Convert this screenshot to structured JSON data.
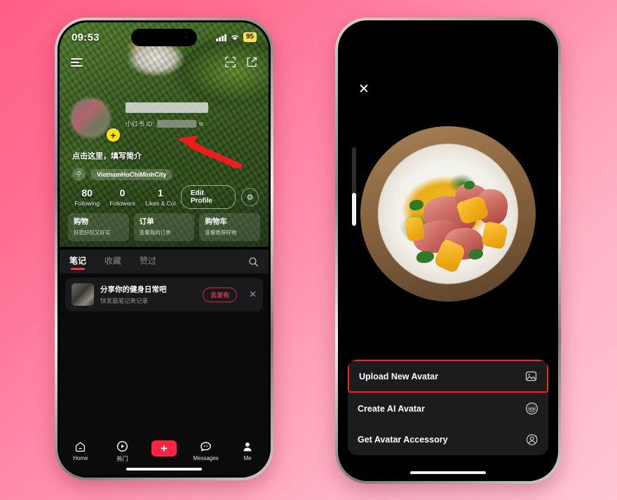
{
  "background": {
    "color_start": "#ff5f86",
    "color_end": "#ffc6d4"
  },
  "left_phone": {
    "status_bar": {
      "time": "09:53",
      "battery": "95",
      "signal_icon": "cellular-signal-icon",
      "wifi_icon": "wifi-icon"
    },
    "header_icons": {
      "menu_icon": "hamburger-menu-icon",
      "scan_icon": "qr-scan-icon",
      "share_icon": "share-icon"
    },
    "profile": {
      "avatar_icon": "avatar",
      "add_badge": "+",
      "id_label": "小红书 ID:",
      "copy_icon": "copy-icon",
      "bio_prompt": "点击这里，填写简介",
      "gender_icon": "gender-icon",
      "location_tag": "VietnamHoChiMinhCity"
    },
    "stats": [
      {
        "num": "80",
        "label": "Following"
      },
      {
        "num": "0",
        "label": "Followers"
      },
      {
        "num": "1",
        "label": "Likes & Col"
      }
    ],
    "actions": {
      "edit_profile": "Edit Profile",
      "settings_icon": "gear-icon"
    },
    "cards": [
      {
        "title": "购物",
        "subtitle": "好逛好玩又好买"
      },
      {
        "title": "订单",
        "subtitle": "查看我的订单"
      },
      {
        "title": "购物车",
        "subtitle": "查看推荐好物"
      }
    ],
    "tabs": [
      {
        "label": "笔记",
        "active": true
      },
      {
        "label": "收藏",
        "active": false
      },
      {
        "label": "赞过",
        "active": false
      }
    ],
    "tab_search_icon": "search-icon",
    "promo": {
      "thumb_icon": "note-thumbnail",
      "title": "分享你的健身日常吧",
      "subtitle": "快发篇笔记来记录",
      "button": "去发布",
      "close_icon": "close-icon"
    },
    "tabbar": [
      {
        "label": "Home",
        "icon": "home-icon"
      },
      {
        "label": "热门",
        "icon": "play-circle-icon"
      },
      {
        "label": "",
        "icon": "plus-button"
      },
      {
        "label": "Messages",
        "icon": "message-icon"
      },
      {
        "label": "Me",
        "icon": "person-icon"
      }
    ],
    "annotation": {
      "arrow_color": "#ee1c1c",
      "badge_color": "#ffe01f"
    }
  },
  "right_phone": {
    "close_icon": "close-icon",
    "photo_alt": "circular-avatar-preview",
    "zoom_slider_icon": "zoom-slider",
    "menu": [
      {
        "label": "Upload New Avatar",
        "icon": "image-icon",
        "highlighted": true
      },
      {
        "label": "Create AI Avatar",
        "icon": "ai-avatar-icon",
        "highlighted": false
      },
      {
        "label": "Get Avatar Accessory",
        "icon": "avatar-accessory-icon",
        "highlighted": false
      }
    ],
    "highlight_color": "#ff1f1f"
  }
}
